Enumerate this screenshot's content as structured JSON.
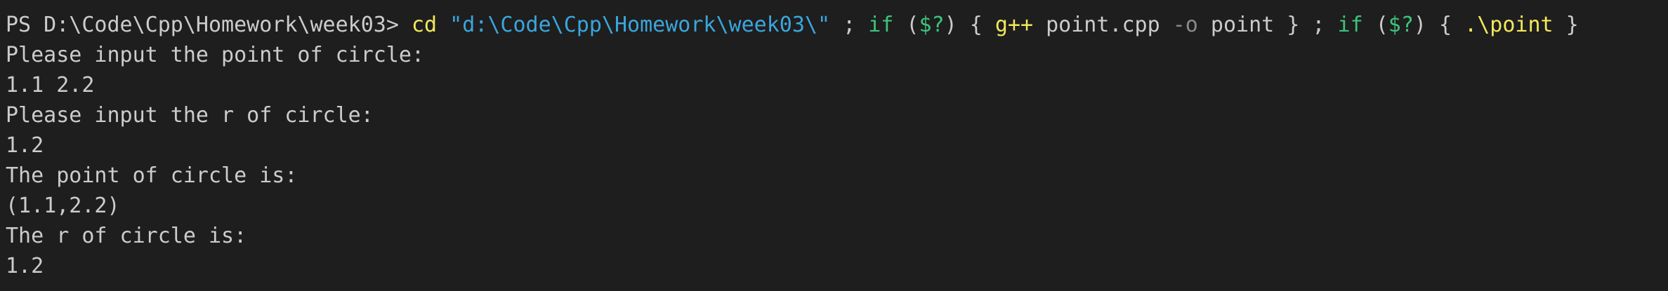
{
  "colors": {
    "background": "#1e1e1e",
    "text": "#cccccc",
    "command": "#f2e85c",
    "string": "#3aa6dd",
    "keyword": "#3cc47c",
    "flag": "#8a8a8a"
  },
  "command_line": {
    "prompt": "PS D:\\Code\\Cpp\\Homework\\week03> ",
    "cd": "cd",
    "sp1": " ",
    "path_string": "\"d:\\Code\\Cpp\\Homework\\week03\\\"",
    "sep1": " ; ",
    "if1": "if",
    "paren_open1": " (",
    "status1": "$?",
    "paren_close1": ") { ",
    "gpp": "g++",
    "compile_args": " point.cpp ",
    "flag_o": "-o",
    "output_name": " point } ; ",
    "if2": "if",
    "paren_open2": " (",
    "status2": "$?",
    "paren_close2": ") { ",
    "run": ".\\point",
    "close": " }"
  },
  "output_lines": [
    "Please input the point of circle:",
    "1.1 2.2",
    "Please input the r of circle:",
    "1.2",
    "The point of circle is:",
    "(1.1,2.2)",
    "The r of circle is:",
    "1.2"
  ]
}
